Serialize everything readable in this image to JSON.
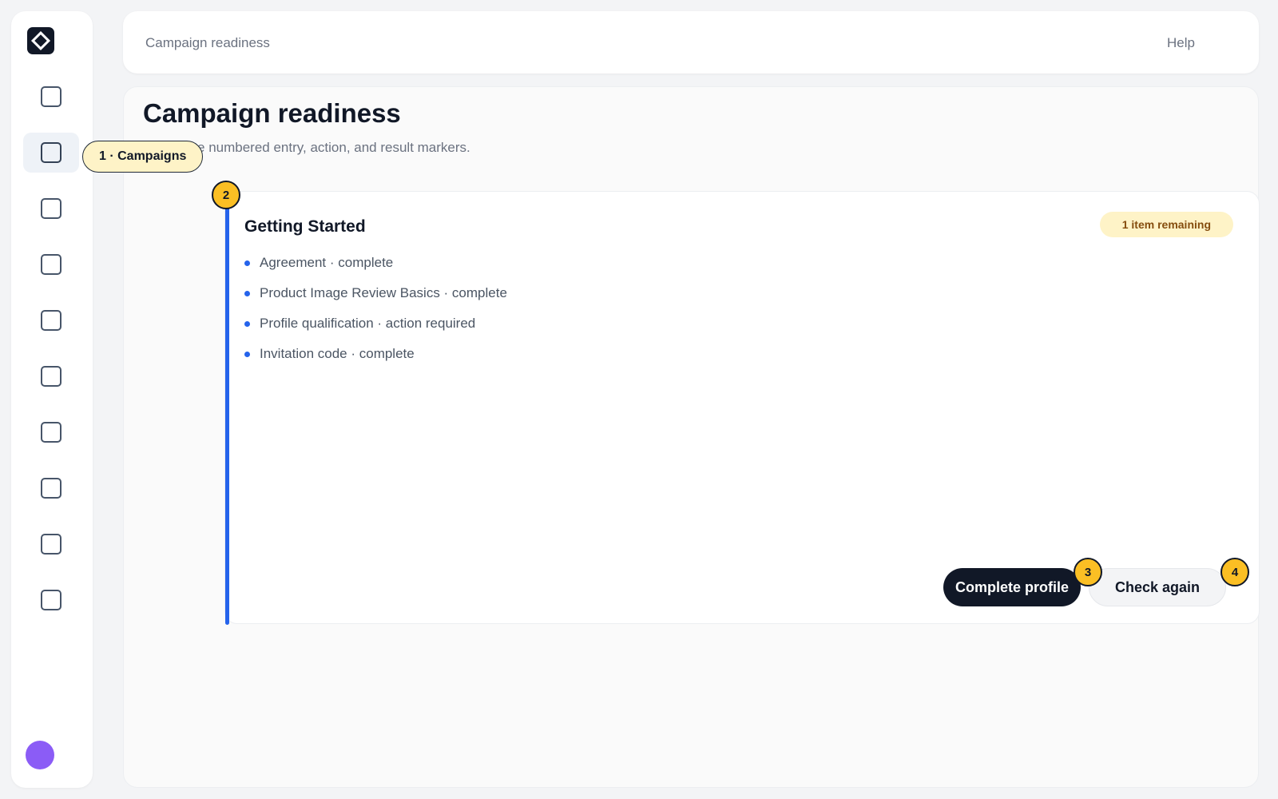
{
  "sidebar": {
    "items": [
      {
        "name": "nav-item-1",
        "active": false
      },
      {
        "name": "nav-item-campaigns",
        "active": true
      },
      {
        "name": "nav-item-3",
        "active": false
      },
      {
        "name": "nav-item-4",
        "active": false
      },
      {
        "name": "nav-item-5",
        "active": false
      },
      {
        "name": "nav-item-6",
        "active": false
      },
      {
        "name": "nav-item-7",
        "active": false
      },
      {
        "name": "nav-item-8",
        "active": false
      },
      {
        "name": "nav-item-9",
        "active": false
      },
      {
        "name": "nav-item-10",
        "active": false
      }
    ],
    "tooltip": "1 · Campaigns"
  },
  "topbar": {
    "title": "Campaign readiness",
    "help_label": "Help"
  },
  "main": {
    "title": "Campaign readiness",
    "subtitle": "Follow the numbered entry, action, and result markers."
  },
  "card": {
    "title": "Getting Started",
    "badge": "1 item remaining",
    "items": [
      "Agreement · complete",
      "Product Image Review Basics · complete",
      "Profile qualification · action required",
      "Invitation code · complete"
    ],
    "primary_button": "Complete profile",
    "secondary_button": "Check again"
  },
  "markers": {
    "card": "2",
    "primary": "3",
    "secondary": "4"
  },
  "colors": {
    "accent": "#2563eb",
    "marker": "#fbbf24",
    "badge_bg": "#fef3c7",
    "avatar": "#8b5cf6"
  }
}
